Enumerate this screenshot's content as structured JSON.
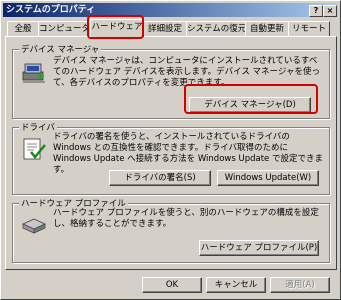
{
  "window": {
    "title": "システムのプロパティ",
    "help_glyph": "?",
    "close_glyph": "×"
  },
  "tabs": [
    {
      "label": "全般"
    },
    {
      "label": "コンピュータ名"
    },
    {
      "label": "ハードウェア"
    },
    {
      "label": "詳細設定"
    },
    {
      "label": "システムの復元"
    },
    {
      "label": "自動更新"
    },
    {
      "label": "リモート"
    }
  ],
  "device_manager": {
    "group_label": "デバイス マネージャ",
    "description": "デバイス マネージャは、コンピュータにインストールされているすべてのハードウェア デバイスを表示します。デバイス マネージャを使って、各デバイスのプロパティを変更できます。",
    "button_label": "デバイス マネージャ(D)"
  },
  "drivers": {
    "group_label": "ドライバ",
    "description": "ドライバの署名を使うと、インストールされているドライバの Windows との互換性を確認できます。ドライバ取得のために Windows Update へ接続する方法を Windows Update で設定できます。",
    "signing_button": "ドライバの署名(S)",
    "update_button": "Windows Update(W)"
  },
  "hardware_profiles": {
    "group_label": "ハードウェア プロファイル",
    "description": "ハードウェア プロファイルを使うと、別のハードウェアの構成を設定し、格納することができます。",
    "button_label": "ハードウェア プロファイル(P)"
  },
  "footer": {
    "ok": "OK",
    "cancel": "キャンセル",
    "apply": "適用(A)"
  }
}
